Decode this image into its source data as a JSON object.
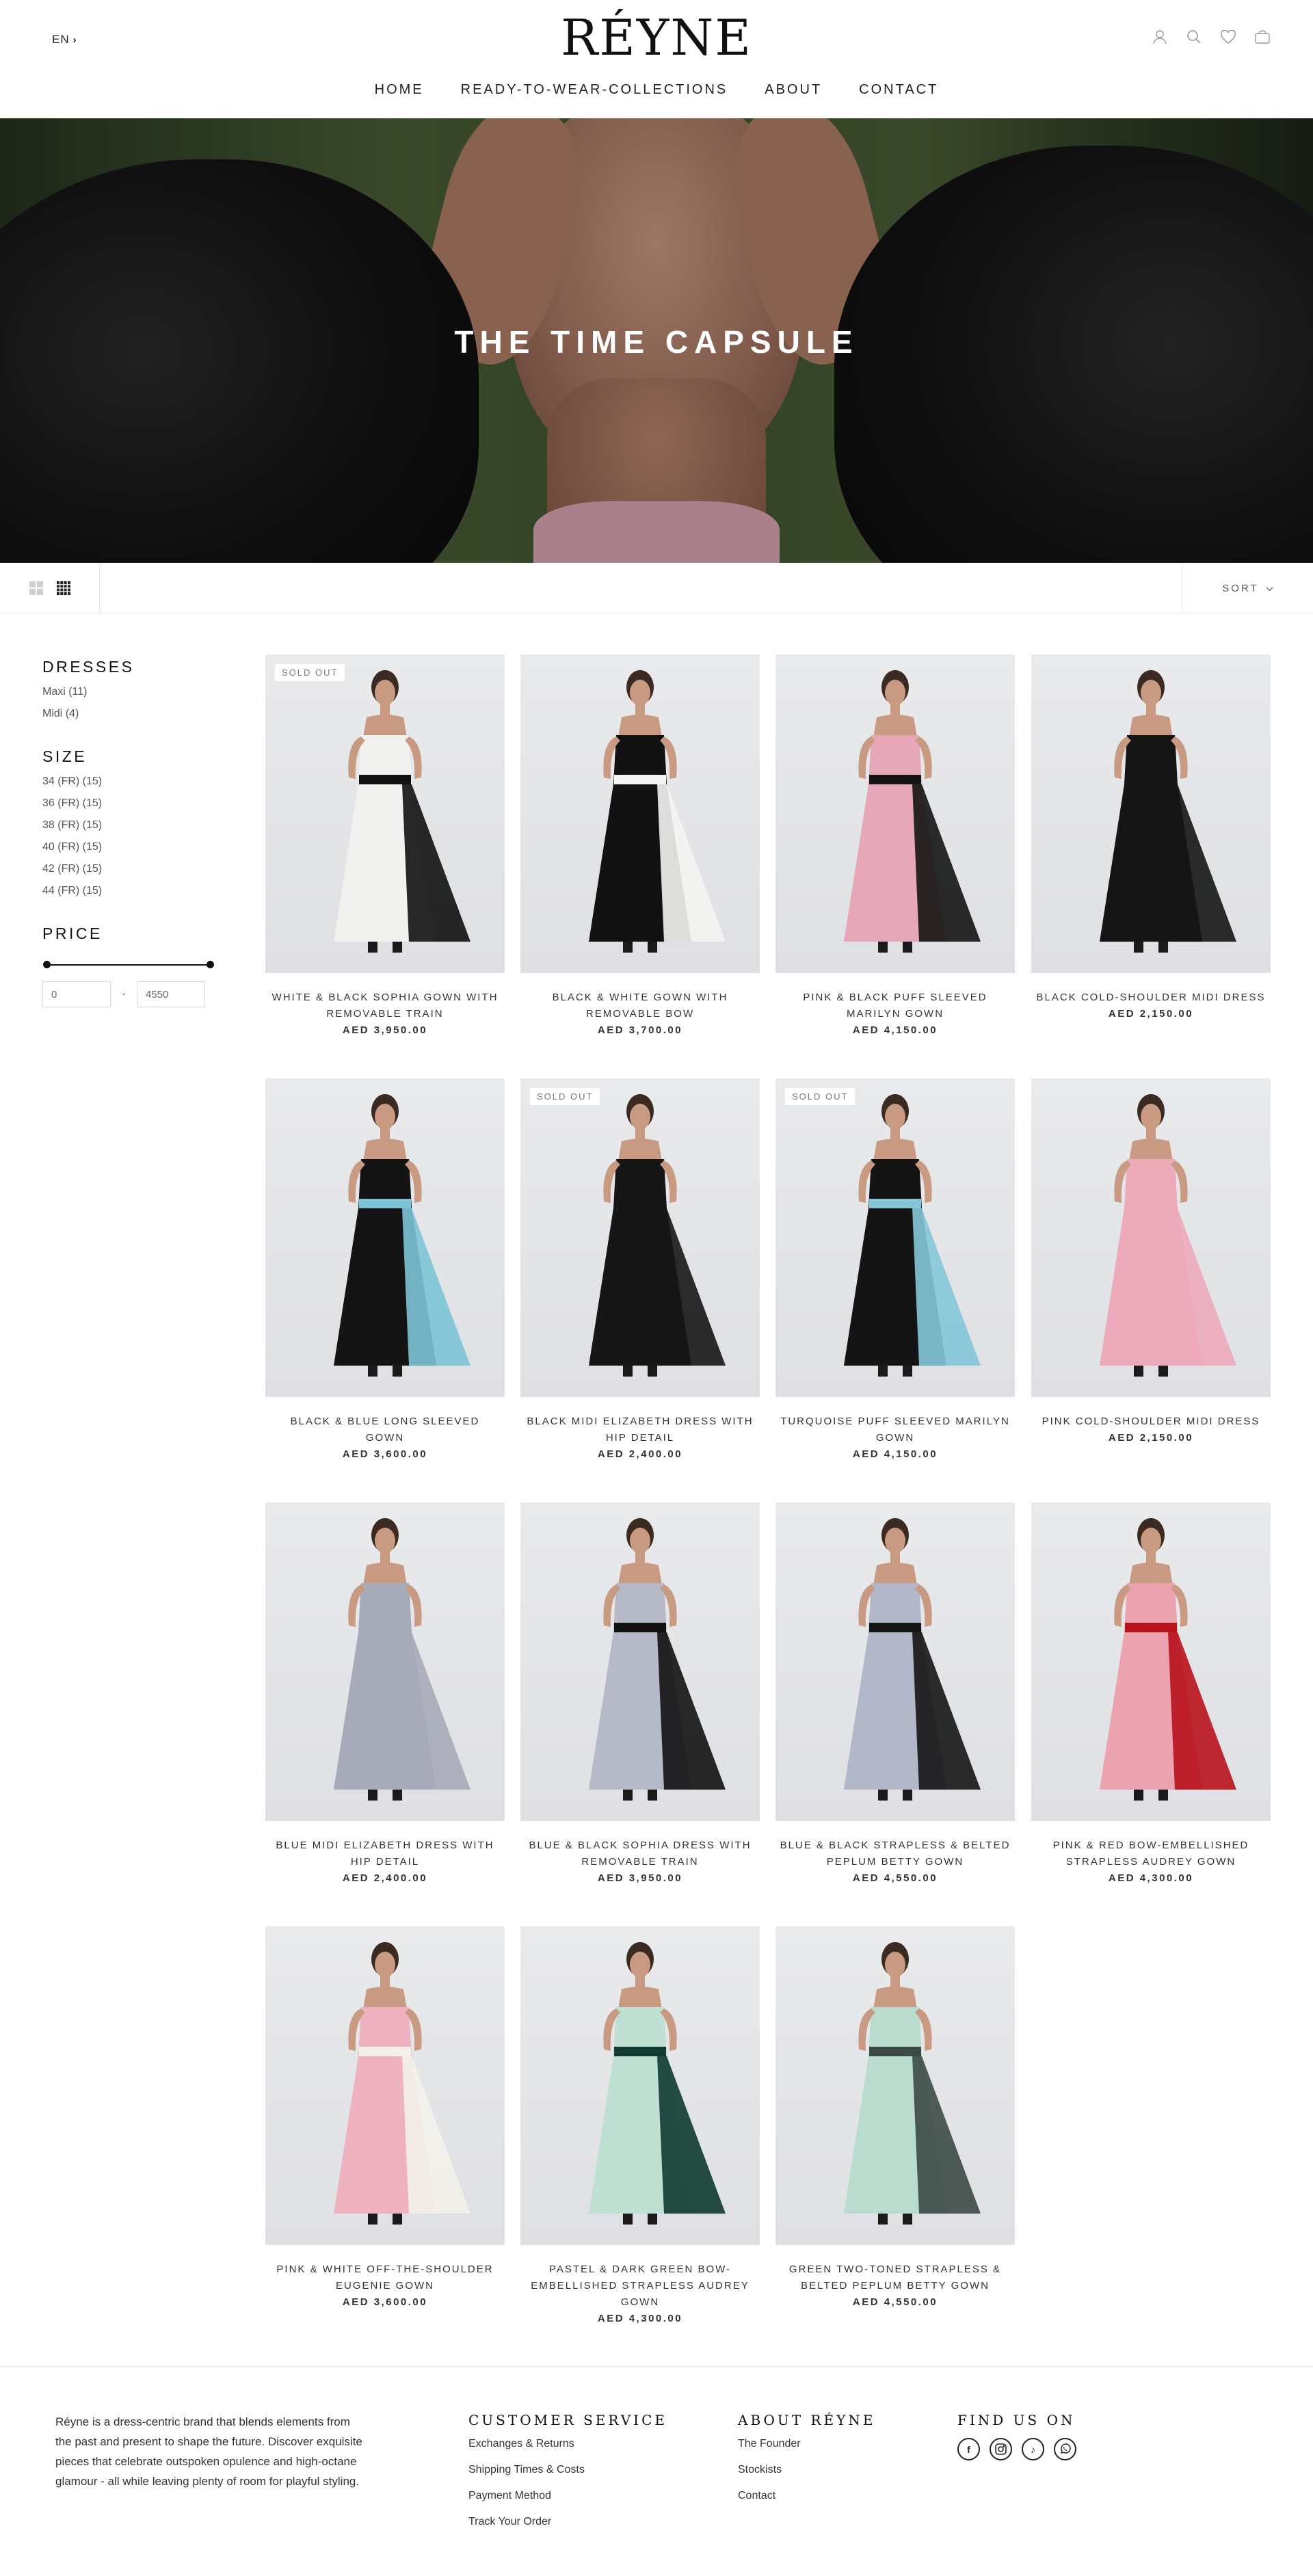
{
  "header": {
    "language": "EN",
    "logo": "RÉYNE",
    "nav": [
      "HOME",
      "READY-TO-WEAR-COLLECTIONS",
      "ABOUT",
      "CONTACT"
    ],
    "icons": [
      "account-icon",
      "search-icon",
      "wishlist-heart-icon",
      "cart-bag-icon"
    ]
  },
  "hero": {
    "title": "THE TIME CAPSULE"
  },
  "toolbar": {
    "sort_label": "SORT"
  },
  "filters": {
    "dresses": {
      "title": "DRESSES",
      "items": [
        "Maxi (11)",
        "Midi (4)"
      ]
    },
    "size": {
      "title": "SIZE",
      "items": [
        "34 (FR) (15)",
        "36 (FR) (15)",
        "38 (FR) (15)",
        "40 (FR) (15)",
        "42 (FR) (15)",
        "44 (FR) (15)"
      ]
    },
    "price": {
      "title": "PRICE",
      "min": "0",
      "max": "4550",
      "separator": "-"
    }
  },
  "products": [
    {
      "name": "WHITE & BLACK SOPHIA GOWN WITH REMOVABLE TRAIN",
      "price": "AED 3,950.00",
      "badge": "SOLD OUT",
      "colors": [
        "#f1f1ef",
        "#111111"
      ]
    },
    {
      "name": "BLACK & WHITE GOWN WITH REMOVABLE BOW",
      "price": "AED 3,700.00",
      "badge": "",
      "colors": [
        "#121212",
        "#f4f4f2"
      ]
    },
    {
      "name": "PINK & BLACK PUFF SLEEVED MARILYN GOWN",
      "price": "AED 4,150.00",
      "badge": "",
      "colors": [
        "#e6a8b8",
        "#141414"
      ]
    },
    {
      "name": "BLACK COLD-SHOULDER MIDI DRESS",
      "price": "AED 2,150.00",
      "badge": "",
      "colors": [
        "#151515",
        "#151515"
      ]
    },
    {
      "name": "BLACK & BLUE LONG SLEEVED GOWN",
      "price": "AED 3,600.00",
      "badge": "",
      "colors": [
        "#141414",
        "#7cc3d6"
      ]
    },
    {
      "name": "BLACK MIDI ELIZABETH DRESS WITH HIP DETAIL",
      "price": "AED 2,400.00",
      "badge": "SOLD OUT",
      "colors": [
        "#161616",
        "#161616"
      ]
    },
    {
      "name": "TURQUOISE PUFF SLEEVED MARILYN GOWN",
      "price": "AED 4,150.00",
      "badge": "SOLD OUT",
      "colors": [
        "#141414",
        "#84c6d8"
      ]
    },
    {
      "name": "PINK COLD-SHOULDER MIDI DRESS",
      "price": "AED 2,150.00",
      "badge": "",
      "colors": [
        "#ecaabb",
        "#ecaabb"
      ]
    },
    {
      "name": "BLUE MIDI ELIZABETH DRESS WITH HIP DETAIL",
      "price": "AED 2,400.00",
      "badge": "",
      "colors": [
        "#a7aab8",
        "#a7aab8"
      ]
    },
    {
      "name": "BLUE & BLACK SOPHIA DRESS WITH REMOVABLE TRAIN",
      "price": "AED 3,950.00",
      "badge": "",
      "colors": [
        "#b6bac8",
        "#121212"
      ]
    },
    {
      "name": "BLUE & BLACK STRAPLESS & BELTED PEPLUM BETTY GOWN",
      "price": "AED 4,550.00",
      "badge": "",
      "colors": [
        "#b3b8c8",
        "#151515"
      ]
    },
    {
      "name": "PINK & RED BOW-EMBELLISHED STRAPLESS AUDREY GOWN",
      "price": "AED 4,300.00",
      "badge": "",
      "colors": [
        "#eba3b0",
        "#b8121c"
      ]
    },
    {
      "name": "PINK & WHITE OFF-THE-SHOULDER EUGENIE GOWN",
      "price": "AED 3,600.00",
      "badge": "",
      "colors": [
        "#efb2c0",
        "#f3f1ea"
      ]
    },
    {
      "name": "PASTEL & DARK GREEN BOW-EMBELLISHED STRAPLESS AUDREY GOWN",
      "price": "AED 4,300.00",
      "badge": "",
      "colors": [
        "#bfe0d3",
        "#0f3b30"
      ]
    },
    {
      "name": "GREEN TWO-TONED STRAPLESS & BELTED PEPLUM BETTY GOWN",
      "price": "AED 4,550.00",
      "badge": "",
      "colors": [
        "#b9dccf",
        "#3c4a45"
      ]
    }
  ],
  "footer": {
    "about": "Réyne is a dress-centric brand that blends elements from the past and present to shape the future. Discover exquisite pieces that celebrate outspoken opulence and high-octane glamour - all while leaving plenty of room for playful styling.",
    "customer_service": {
      "title": "CUSTOMER SERVICE",
      "links": [
        "Exchanges & Returns",
        "Shipping Times & Costs",
        "Payment Method",
        "Track Your Order"
      ]
    },
    "about_reyne": {
      "title": "ABOUT RÉYNE",
      "links": [
        "The Founder",
        "Stockists",
        "Contact"
      ]
    },
    "find_us": {
      "title": "FIND US ON",
      "socials": [
        "facebook-icon",
        "instagram-icon",
        "tiktok-icon",
        "whatsapp-icon"
      ]
    }
  }
}
